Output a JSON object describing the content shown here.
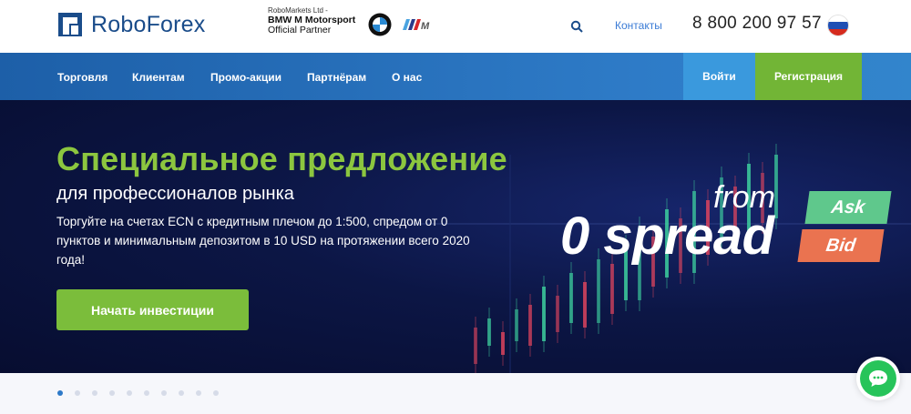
{
  "header": {
    "logo_text": "RoboForex",
    "partner_line1": "RoboMarkets Ltd -",
    "partner_line2": "BMW M Motorsport",
    "partner_line3": "Official Partner",
    "contacts_label": "Контакты",
    "phone": "8 800 200 97 57",
    "language": "ru-flag"
  },
  "nav": {
    "items": [
      "Торговля",
      "Клиентам",
      "Промо-акции",
      "Партнёрам",
      "О нас"
    ],
    "login_label": "Войти",
    "register_label": "Регистрация"
  },
  "hero": {
    "title": "Специальное предложение",
    "subtitle": "для профессионалов рынка",
    "text": "Торгуйте на счетах ECN с кредитным плечом до 1:500, спредом от 0 пунктов и минимальным депозитом в 10 USD на протяжении всего 2020 года!",
    "cta_label": "Начать инвестиции",
    "promo_from": "from",
    "promo_spread": "0 spread",
    "ask_label": "Ask",
    "bid_label": "Bid"
  },
  "slider": {
    "total_slides": 10,
    "active_slide": 1
  },
  "colors": {
    "brand_blue": "#1a4c8a",
    "green": "#8cc63f",
    "ask": "#5fc88c",
    "bid": "#ea7350"
  }
}
